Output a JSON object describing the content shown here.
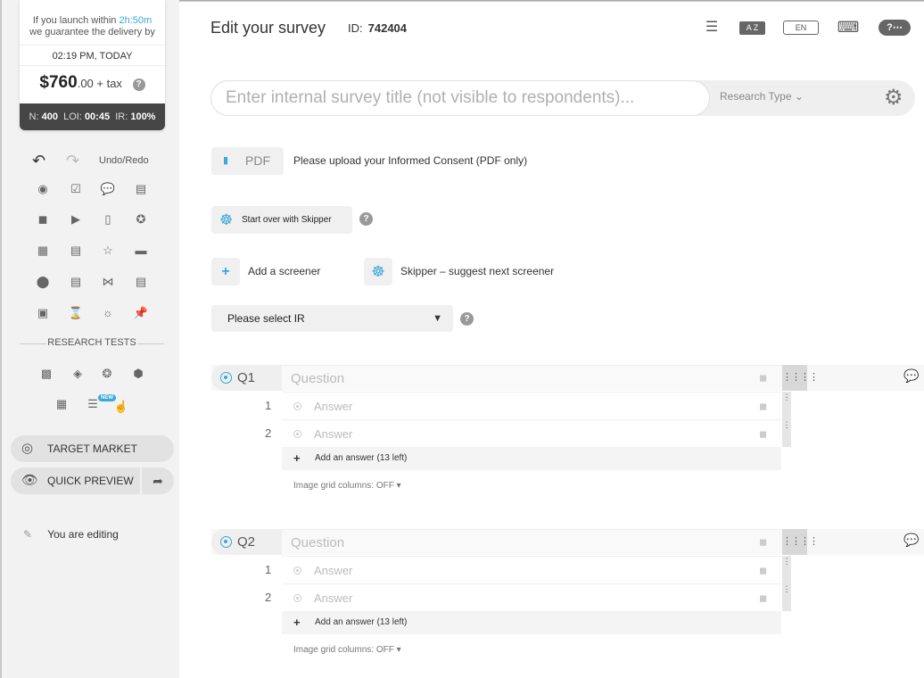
{
  "sidebar": {
    "price_card": {
      "launch_prefix": "If you launch within",
      "launch_time": "2h:50m",
      "launch_suffix": "we guarantee the delivery by",
      "delivery_time": "02:19 PM, TODAY",
      "price_main": "$760",
      "price_suffix": ".00 + tax",
      "help": "?",
      "stats_n_label": "N:",
      "stats_n": "400",
      "stats_loi_label": "LOI:",
      "stats_loi": "00:45",
      "stats_ir_label": "IR:",
      "stats_ir": "100%"
    },
    "undo_redo_label": "Undo/Redo",
    "research_tests_title": "RESEARCH TESTS",
    "new_badge": "NEW",
    "target_market_label": "TARGET MARKET",
    "quick_preview_label": "QUICK PREVIEW",
    "editing_label": "You are editing"
  },
  "header": {
    "title": "Edit your survey",
    "id_label": "ID:",
    "id_value": "742404",
    "lang": "EN",
    "az_label": "A Z"
  },
  "form": {
    "title_placeholder": "Enter internal survey title (not visible to respondents)...",
    "research_type_label": "Research Type",
    "pdf_label": "PDF",
    "pdf_text": "Please upload your Informed Consent (PDF only)",
    "skipper_start_label": "Start over with Skipper",
    "add_screener_label": "Add a screener",
    "skipper_suggest_label": "Skipper – suggest next screener",
    "ir_select_label": "Please select IR"
  },
  "questions": [
    {
      "label": "Q1",
      "placeholder": "Question",
      "answers": [
        {
          "num": "1",
          "placeholder": "Answer"
        },
        {
          "num": "2",
          "placeholder": "Answer"
        }
      ],
      "add_answer_label": "Add an answer (13 left)",
      "grid_columns_label": "Image grid columns: OFF"
    },
    {
      "label": "Q2",
      "placeholder": "Question",
      "answers": [
        {
          "num": "1",
          "placeholder": "Answer"
        },
        {
          "num": "2",
          "placeholder": "Answer"
        }
      ],
      "add_answer_label": "Add an answer (13 left)",
      "grid_columns_label": "Image grid columns: OFF"
    }
  ],
  "colors": {
    "accent": "#3aa8d8",
    "sidebar_bg": "#f2f2f2",
    "stats_bg": "#454545"
  },
  "icons": {
    "tools": [
      "radio-icon",
      "checkbox-icon",
      "speech-bubble-icon",
      "comment-icon",
      "camera-icon",
      "video-icon",
      "mobile-icon",
      "award-icon",
      "calendar-icon",
      "form-icon",
      "star-icon",
      "slider-icon",
      "ranking-icon",
      "list-icon",
      "bowtie-icon",
      "clipboard-icon",
      "dropdown-icon",
      "hourglass-icon",
      "eye-icon",
      "pin-icon"
    ],
    "research_tests": [
      "bar-chart-icon",
      "tag-icon",
      "share-nodes-icon",
      "cube-icon",
      "grid-chart-icon",
      "new-test-icon",
      "hand-cursor-icon"
    ]
  }
}
